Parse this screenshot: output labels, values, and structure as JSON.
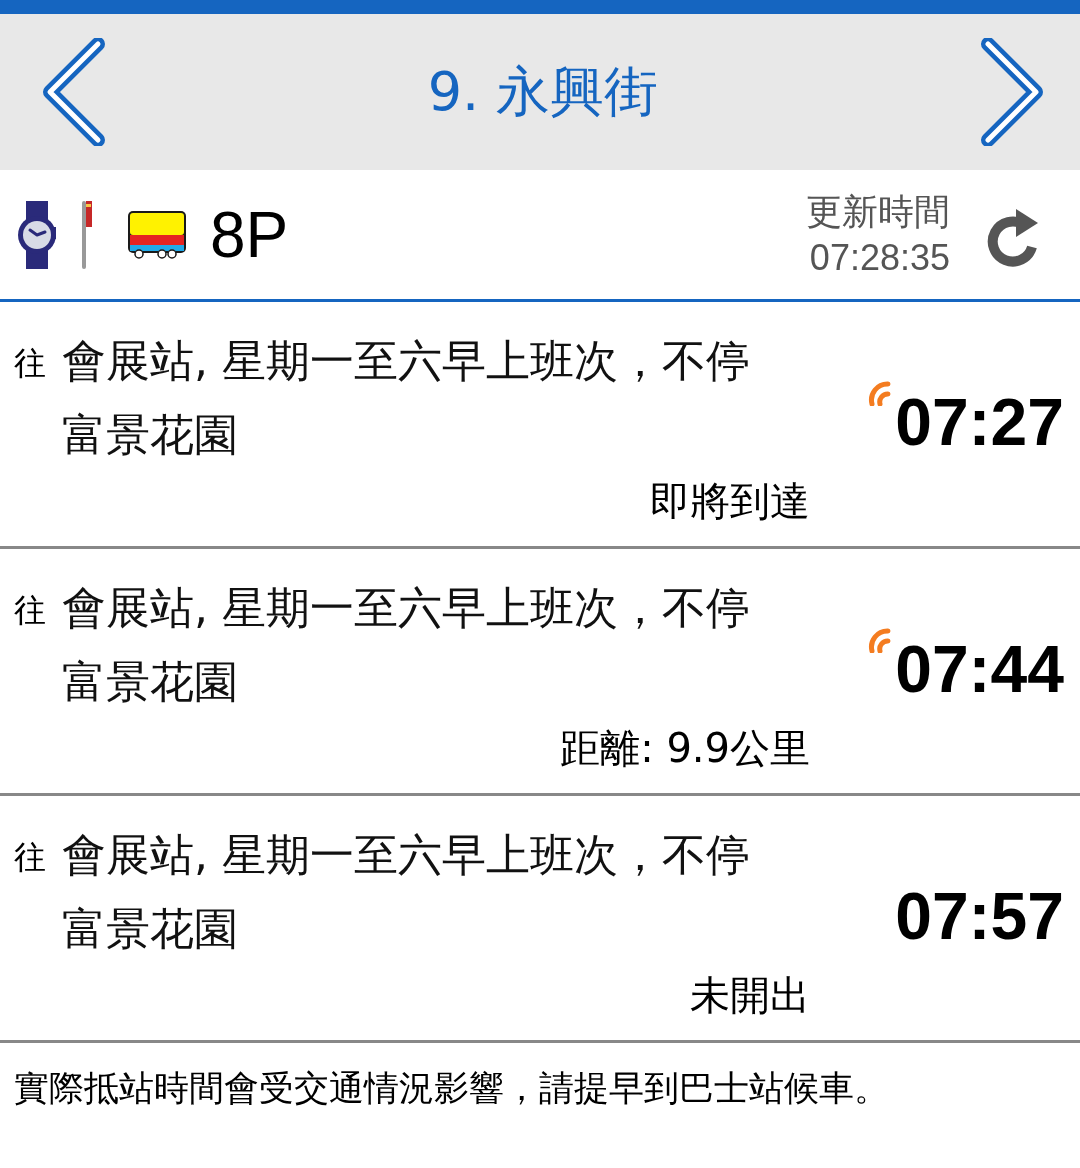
{
  "header": {
    "title": "9. 永興街"
  },
  "route": {
    "number": "8P",
    "update_label": "更新時間",
    "update_time": "07:28:35"
  },
  "arrivals": [
    {
      "prefix": "往",
      "destination": "會展站, 星期一至六早上班次，不停富景花園",
      "time": "07:27",
      "live": true,
      "status": "即將到達"
    },
    {
      "prefix": "往",
      "destination": "會展站, 星期一至六早上班次，不停富景花園",
      "time": "07:44",
      "live": true,
      "status": "距離: 9.9公里"
    },
    {
      "prefix": "往",
      "destination": "會展站, 星期一至六早上班次，不停富景花園",
      "time": "07:57",
      "live": false,
      "status": "未開出"
    }
  ],
  "footer": {
    "note": "實際抵站時間會受交通情況影響，請提早到巴士站候車。"
  }
}
